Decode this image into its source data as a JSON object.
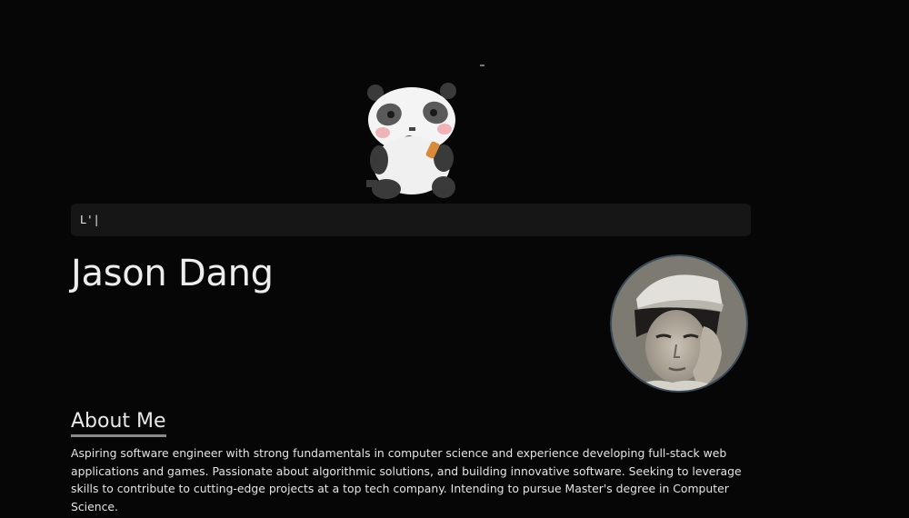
{
  "prompt": {
    "text": "L'|"
  },
  "profile": {
    "name": "Jason Dang"
  },
  "about": {
    "heading": "About Me",
    "body": "Aspiring software engineer with strong fundamentals in computer science and experience developing full-stack web applications and games. Passionate about algorithmic solutions, and building innovative software. Seeking to leverage skills to contribute to cutting-edge projects at a top tech company. Intending to pursue Master's degree in Computer Science."
  },
  "icons": {
    "mascot": "panda-mascot-icon",
    "avatar": "profile-avatar-photo"
  },
  "colors": {
    "background": "#060606",
    "prompt_bar": "#161616",
    "heading_underline": "#8a8a8a",
    "avatar_ring": "#3a4a58"
  }
}
